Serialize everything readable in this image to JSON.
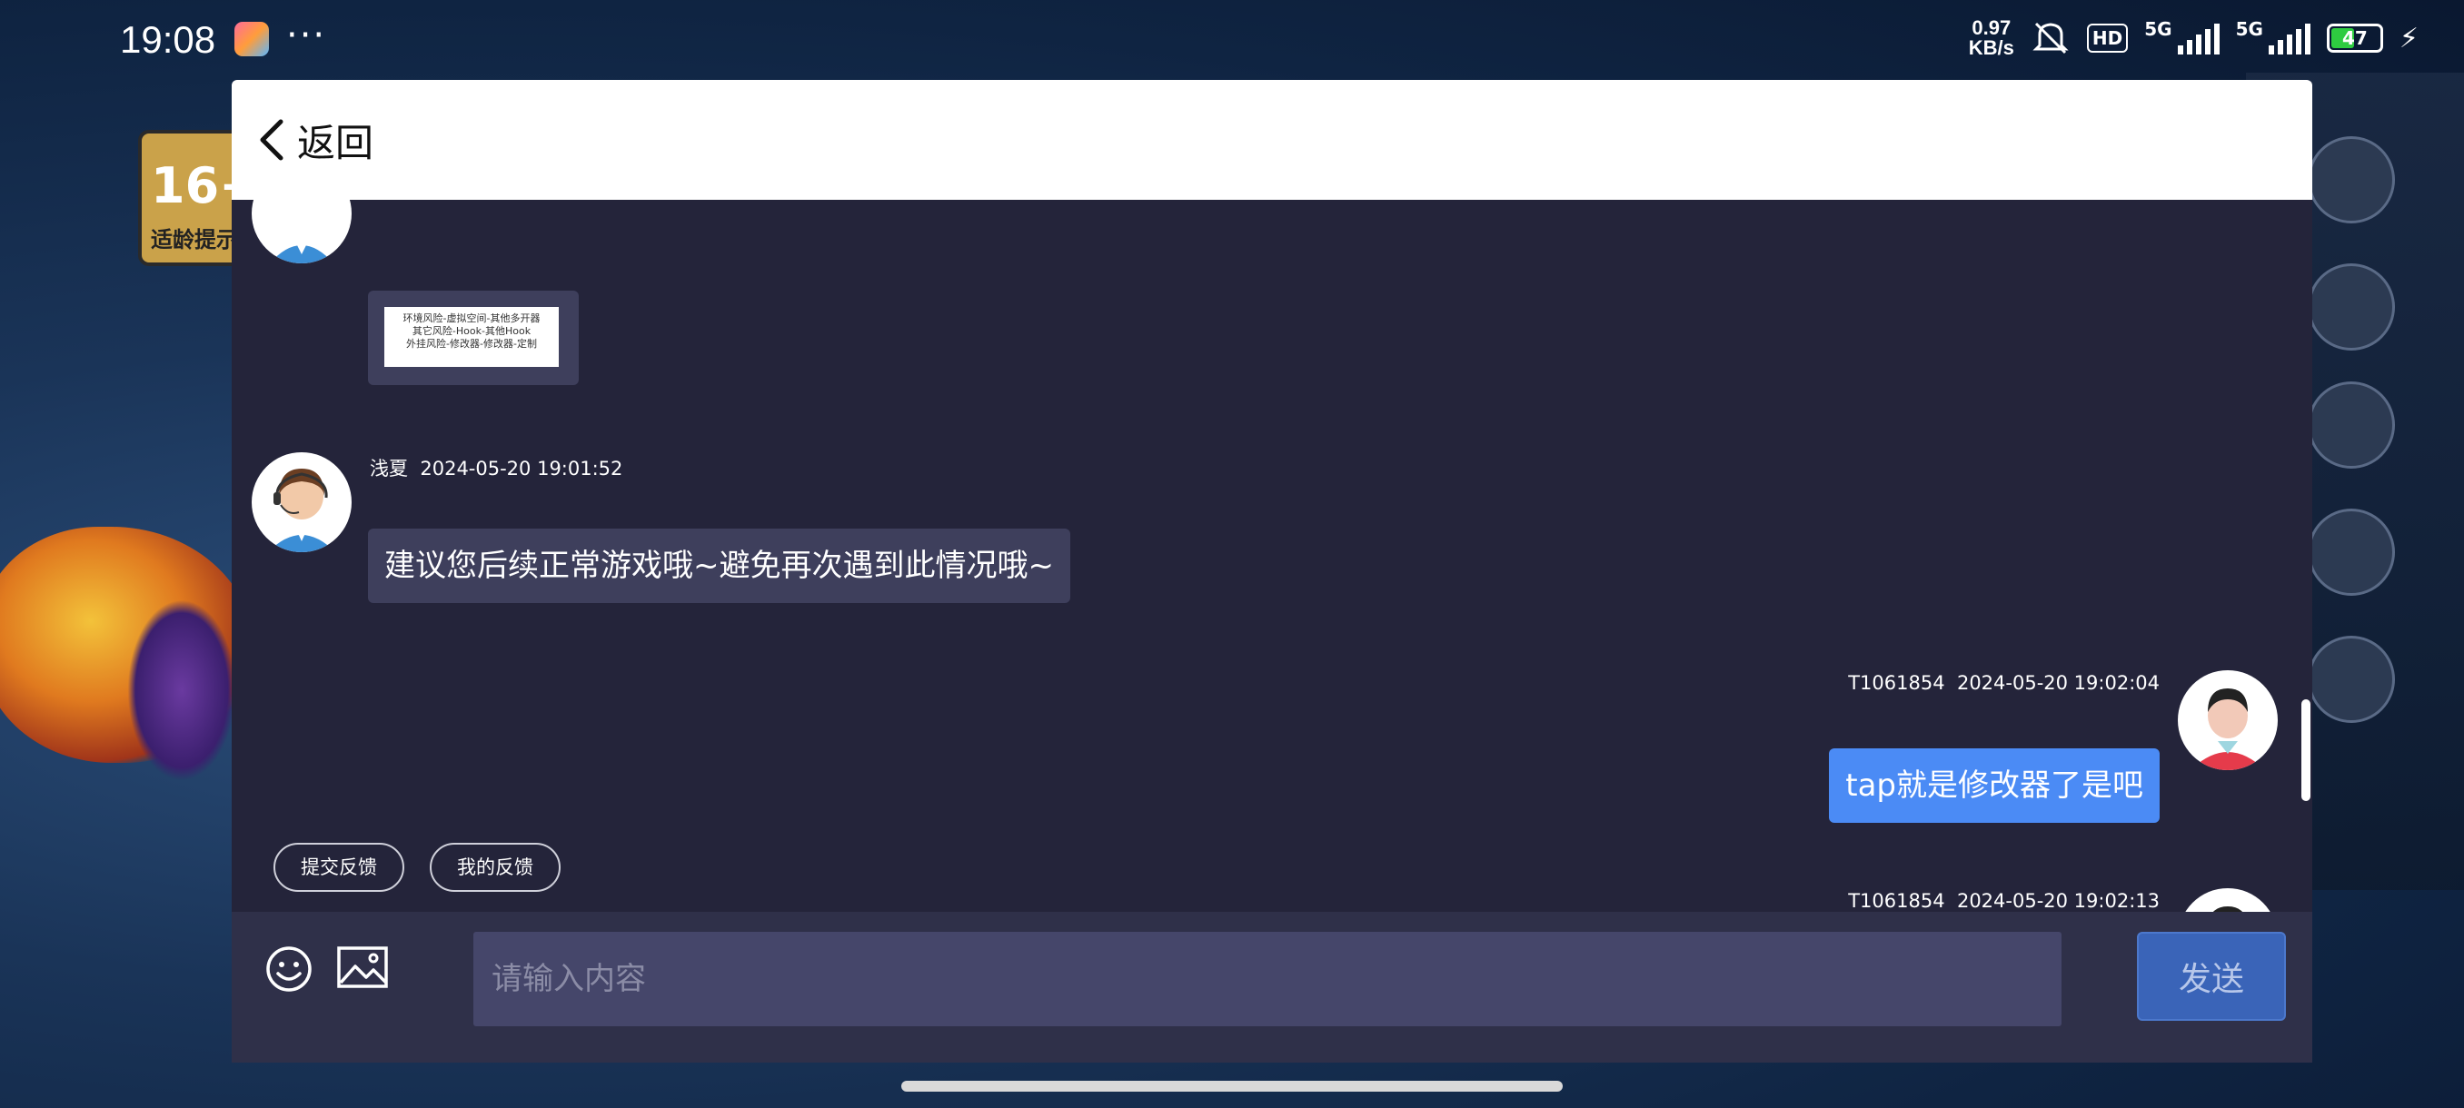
{
  "status_bar": {
    "time": "19:08",
    "dots": "···",
    "net_speed_value": "0.97",
    "net_speed_unit": "KB/s",
    "hd_label": "HD",
    "network_1": "5G",
    "network_2": "5G",
    "battery_level": "47"
  },
  "background": {
    "age_rating": "16+",
    "age_rating_text": "适龄提示"
  },
  "header": {
    "back_label": "返回"
  },
  "messages": [
    {
      "side": "left",
      "type": "image",
      "image_lines": [
        "环境风险-虚拟空间-其他多开器",
        "其它风险-Hook-其他Hook",
        "外挂风险-修改器-修改器-定制"
      ]
    },
    {
      "side": "left",
      "sender": "浅夏",
      "timestamp": "2024-05-20 19:01:52",
      "text": "建议您后续正常游戏哦~避免再次遇到此情况哦~"
    },
    {
      "side": "right",
      "sender": "T1061854",
      "timestamp": "2024-05-20 19:02:04",
      "text": "tap就是修改器了是吧"
    },
    {
      "side": "right",
      "sender": "T1061854",
      "timestamp": "2024-05-20 19:02:13",
      "text": ""
    }
  ],
  "quick_actions": {
    "submit_feedback": "提交反馈",
    "my_feedback": "我的反馈"
  },
  "input": {
    "placeholder": "请输入内容",
    "send_label": "发送"
  },
  "colors": {
    "dialog_bg": "#24243a",
    "agent_bubble": "#3e3f5c",
    "user_bubble": "#4b8bf5",
    "send_button": "#3a64b8"
  }
}
